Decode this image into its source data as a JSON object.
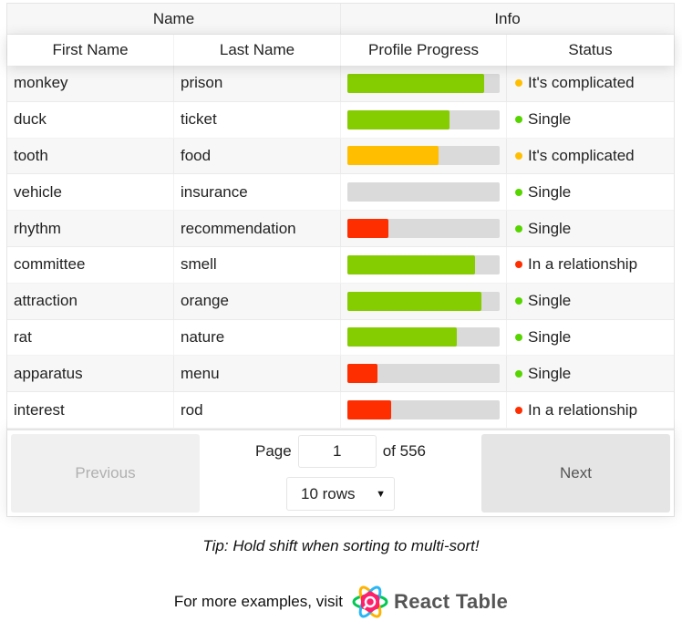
{
  "table": {
    "groups": [
      "Name",
      "Info"
    ],
    "columns": [
      "First Name",
      "Last Name",
      "Profile Progress",
      "Status"
    ],
    "rows": [
      {
        "first": "monkey",
        "last": "prison",
        "progress": 90,
        "status": "It's complicated"
      },
      {
        "first": "duck",
        "last": "ticket",
        "progress": 67,
        "status": "Single"
      },
      {
        "first": "tooth",
        "last": "food",
        "progress": 60,
        "status": "It's complicated"
      },
      {
        "first": "vehicle",
        "last": "insurance",
        "progress": 0,
        "status": "Single"
      },
      {
        "first": "rhythm",
        "last": "recommendation",
        "progress": 27,
        "status": "Single"
      },
      {
        "first": "committee",
        "last": "smell",
        "progress": 84,
        "status": "In a relationship"
      },
      {
        "first": "attraction",
        "last": "orange",
        "progress": 88,
        "status": "Single"
      },
      {
        "first": "rat",
        "last": "nature",
        "progress": 72,
        "status": "Single"
      },
      {
        "first": "apparatus",
        "last": "menu",
        "progress": 20,
        "status": "Single"
      },
      {
        "first": "interest",
        "last": "rod",
        "progress": 29,
        "status": "In a relationship"
      }
    ]
  },
  "colors": {
    "progress_high": "#85cc00",
    "progress_mid": "#ffbf00",
    "progress_low": "#ff2e00",
    "status_single": "#57d500",
    "status_complicated": "#ffbf00",
    "status_relationship": "#ff2e00"
  },
  "pagination": {
    "previous_label": "Previous",
    "next_label": "Next",
    "page_label": "Page",
    "current_page": "1",
    "of_label": "of 556",
    "rows_selected": "10 rows"
  },
  "tip": "Tip: Hold shift when sorting to multi-sort!",
  "footer": {
    "text": "For more examples, visit",
    "brand": "React Table"
  }
}
